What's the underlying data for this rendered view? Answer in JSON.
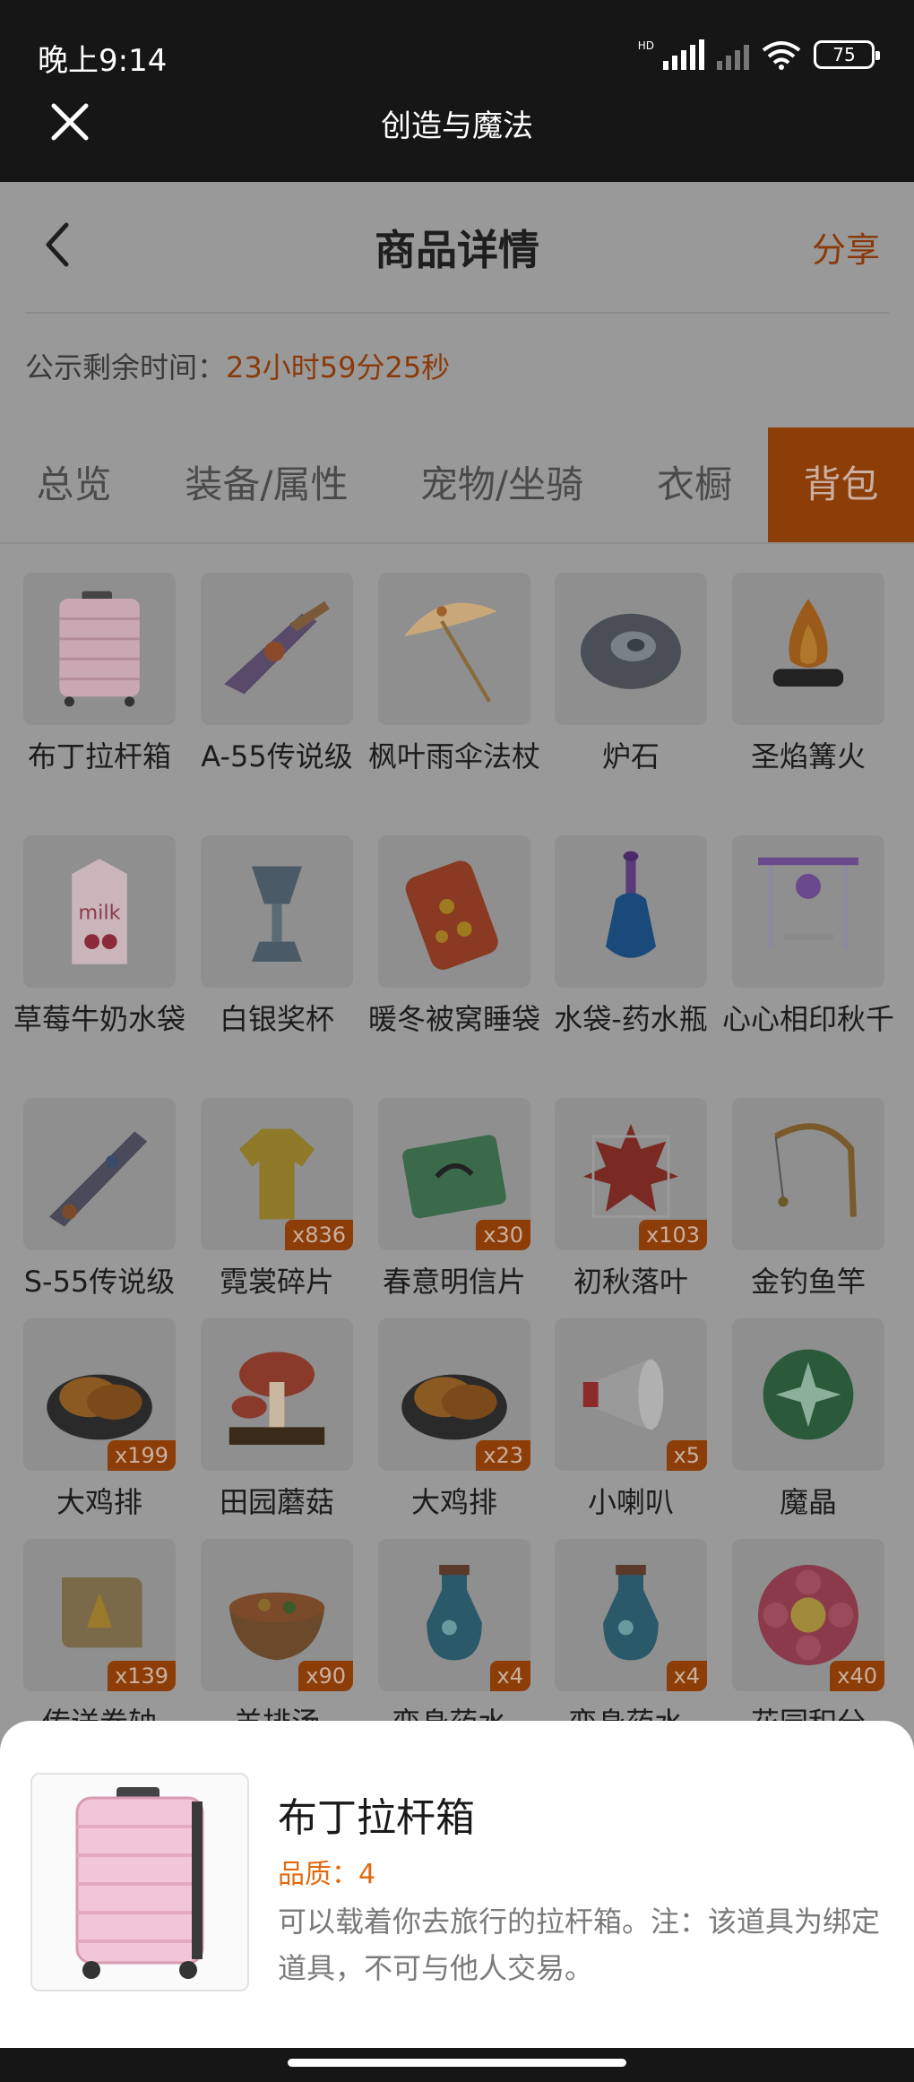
{
  "status": {
    "time": "晚上9:14",
    "hd": "HD",
    "battery": "75"
  },
  "app": {
    "title": "创造与魔法"
  },
  "nav": {
    "title": "商品详情",
    "share": "分享"
  },
  "timer": {
    "label": "公示剩余时间：",
    "value": "23小时59分25秒"
  },
  "tabs": [
    {
      "label": "总览",
      "active": false
    },
    {
      "label": "装备/属性",
      "active": false
    },
    {
      "label": "宠物/坐骑",
      "active": false
    },
    {
      "label": "衣橱",
      "active": false
    },
    {
      "label": "背包",
      "active": true
    }
  ],
  "items": [
    {
      "name": "布丁拉杆箱",
      "qty": "",
      "icon": "suitcase-icon"
    },
    {
      "name": "A-55传说级",
      "qty": "",
      "icon": "rifle-icon"
    },
    {
      "name": "枫叶雨伞法杖",
      "qty": "",
      "icon": "umbrella-icon"
    },
    {
      "name": "炉石",
      "qty": "",
      "icon": "hearthstone-icon"
    },
    {
      "name": "圣焰篝火",
      "qty": "",
      "icon": "bonfire-icon"
    },
    {
      "name": "草莓牛奶水袋",
      "qty": "",
      "icon": "milk-carton-icon"
    },
    {
      "name": "白银奖杯",
      "qty": "",
      "icon": "trophy-icon"
    },
    {
      "name": "暖冬被窝睡袋",
      "qty": "",
      "icon": "sleeping-bag-icon"
    },
    {
      "name": "水袋-药水瓶",
      "qty": "",
      "icon": "potion-bottle-icon"
    },
    {
      "name": "心心相印秋千",
      "qty": "",
      "icon": "swing-icon"
    },
    {
      "name": "S-55传说级",
      "qty": "",
      "icon": "gun-icon"
    },
    {
      "name": "霓裳碎片",
      "qty": "x836",
      "icon": "shirt-icon"
    },
    {
      "name": "春意明信片",
      "qty": "x30",
      "icon": "postcard-icon"
    },
    {
      "name": "初秋落叶",
      "qty": "x103",
      "icon": "maple-leaf-icon"
    },
    {
      "name": "金钓鱼竿",
      "qty": "",
      "icon": "fishing-rod-icon"
    },
    {
      "name": "大鸡排",
      "qty": "x199",
      "icon": "chicken-cutlet-icon"
    },
    {
      "name": "田园蘑菇",
      "qty": "",
      "icon": "mushroom-icon"
    },
    {
      "name": "大鸡排",
      "qty": "x23",
      "icon": "chicken-cutlet-icon"
    },
    {
      "name": "小喇叭",
      "qty": "x5",
      "icon": "megaphone-icon"
    },
    {
      "name": "魔晶",
      "qty": "",
      "icon": "magic-crystal-icon"
    },
    {
      "name": "传送卷轴",
      "qty": "x139",
      "icon": "scroll-icon"
    },
    {
      "name": "羊排汤",
      "qty": "x90",
      "icon": "soup-bowl-icon"
    },
    {
      "name": "变身药水-",
      "qty": "x4",
      "icon": "potion-icon"
    },
    {
      "name": "变身药水-",
      "qty": "x4",
      "icon": "potion-icon"
    },
    {
      "name": "花园积分",
      "qty": "x40",
      "icon": "flower-token-icon"
    }
  ],
  "detail": {
    "name": "布丁拉杆箱",
    "quality": "品质：4",
    "description": "可以载着你去旅行的拉杆箱。注：该道具为绑定道具，不可与他人交易。"
  }
}
